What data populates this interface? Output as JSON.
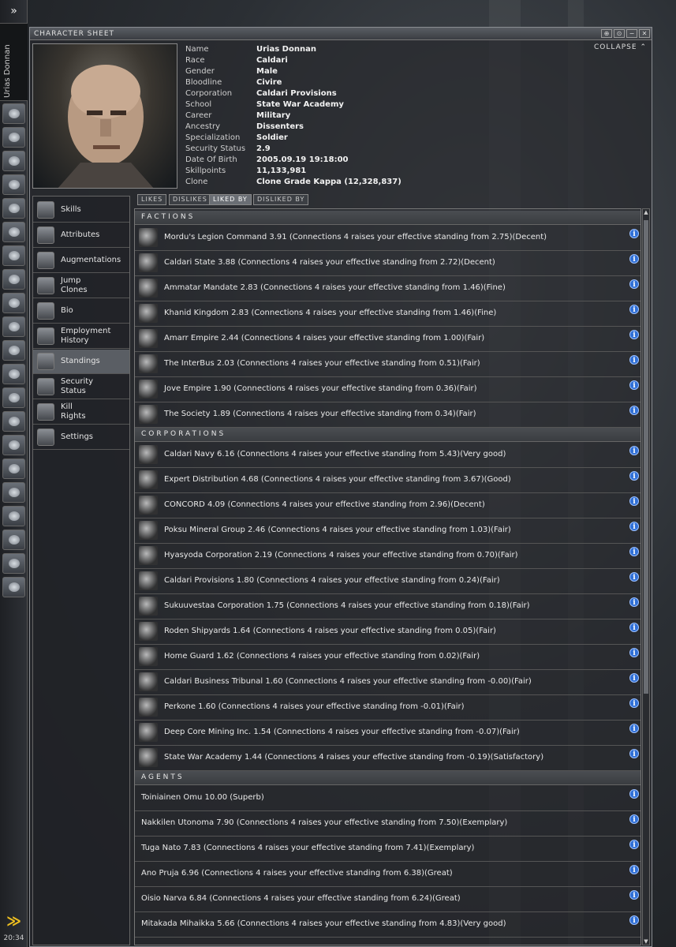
{
  "window": {
    "title": "CHARACTER SHEET",
    "collapse_label": "COLLAPSE",
    "collapse_glyph": "⌃",
    "buttons": [
      "⊕",
      "⊙",
      "−",
      "✕"
    ]
  },
  "neocom": {
    "menu_glyph": "»",
    "character_name": "Urias Donnan",
    "time": "20:34",
    "arrows_glyph": "≫"
  },
  "character": {
    "fields": [
      {
        "label": "Name",
        "value": "Urias Donnan"
      },
      {
        "label": "Race",
        "value": "Caldari"
      },
      {
        "label": "Gender",
        "value": "Male"
      },
      {
        "label": "Bloodline",
        "value": "Civire"
      },
      {
        "label": "Corporation",
        "value": "Caldari Provisions"
      },
      {
        "label": "School",
        "value": "State War Academy"
      },
      {
        "label": "Career",
        "value": "Military"
      },
      {
        "label": "Ancestry",
        "value": "Dissenters"
      },
      {
        "label": "Specialization",
        "value": "Soldier"
      },
      {
        "label": "Security Status",
        "value": "2.9"
      },
      {
        "label": "Date Of Birth",
        "value": "2005.09.19 19:18:00"
      },
      {
        "label": "Skillpoints",
        "value": "11,133,981"
      },
      {
        "label": "Clone",
        "value": "Clone Grade Kappa (12,328,837)"
      }
    ]
  },
  "nav": {
    "items": [
      {
        "label": "Skills",
        "icon": "skills-icon"
      },
      {
        "label": "Attributes",
        "icon": "attributes-icon"
      },
      {
        "label": "Augmentations",
        "icon": "augmentations-icon"
      },
      {
        "label": "Jump\nClones",
        "icon": "jump-clones-icon"
      },
      {
        "label": "Bio",
        "icon": "bio-icon"
      },
      {
        "label": "Employment\nHistory",
        "icon": "employment-history-icon"
      },
      {
        "label": "Standings",
        "icon": "standings-icon"
      },
      {
        "label": "Security\nStatus",
        "icon": "security-status-icon"
      },
      {
        "label": "Kill\nRights",
        "icon": "kill-rights-icon"
      },
      {
        "label": "Settings",
        "icon": "settings-icon"
      }
    ],
    "active": "Standings"
  },
  "tabs": [
    "LIKES",
    "DISLIKES",
    "LIKED BY",
    "DISLIKED BY"
  ],
  "active_tab": "LIKED BY",
  "standings": {
    "factions_header": "FACTIONS",
    "factions": [
      "Mordu's Legion Command 3.91 (Connections 4 raises your effective standing from 2.75)(Decent)",
      "Caldari State 3.88 (Connections 4 raises your effective standing from 2.72)(Decent)",
      "Ammatar Mandate 2.83 (Connections 4 raises your effective standing from 1.46)(Fine)",
      "Khanid Kingdom 2.83 (Connections 4 raises your effective standing from 1.46)(Fine)",
      "Amarr Empire 2.44 (Connections 4 raises your effective standing from 1.00)(Fair)",
      "The InterBus 2.03 (Connections 4 raises your effective standing from 0.51)(Fair)",
      "Jove Empire 1.90 (Connections 4 raises your effective standing from 0.36)(Fair)",
      "The Society 1.89 (Connections 4 raises your effective standing from 0.34)(Fair)"
    ],
    "corporations_header": "CORPORATIONS",
    "corporations": [
      "Caldari Navy 6.16 (Connections 4 raises your effective standing from 5.43)(Very good)",
      "Expert Distribution 4.68 (Connections 4 raises your effective standing from 3.67)(Good)",
      "CONCORD 4.09 (Connections 4 raises your effective standing from 2.96)(Decent)",
      "Poksu Mineral Group 2.46 (Connections 4 raises your effective standing from 1.03)(Fair)",
      "Hyasyoda Corporation 2.19 (Connections 4 raises your effective standing from 0.70)(Fair)",
      "Caldari Provisions 1.80 (Connections 4 raises your effective standing from 0.24)(Fair)",
      "Sukuuvestaa Corporation 1.75 (Connections 4 raises your effective standing from 0.18)(Fair)",
      "Roden Shipyards 1.64 (Connections 4 raises your effective standing from 0.05)(Fair)",
      "Home Guard 1.62 (Connections 4 raises your effective standing from 0.02)(Fair)",
      "Caldari Business Tribunal 1.60 (Connections 4 raises your effective standing from -0.00)(Fair)",
      "Perkone 1.60 (Connections 4 raises your effective standing from -0.01)(Fair)",
      "Deep Core Mining Inc. 1.54 (Connections 4 raises your effective standing from -0.07)(Fair)",
      "State War Academy 1.44 (Connections 4 raises your effective standing from -0.19)(Satisfactory)"
    ],
    "agents_header": "AGENTS",
    "agents": [
      "Toiniainen Omu 10.00 (Superb)",
      "Nakkilen Utonoma 7.90 (Connections 4 raises your effective standing from 7.50)(Exemplary)",
      "Tuga Nato 7.83 (Connections 4 raises your effective standing from 7.41)(Exemplary)",
      "Ano Pruja 6.96 (Connections 4 raises your effective standing from 6.38)(Great)",
      "Oisio Narva 6.84 (Connections 4 raises your effective standing from 6.24)(Great)",
      "Mitakada Mihaikka 5.66 (Connections 4 raises your effective standing from 4.83)(Very good)"
    ],
    "info_glyph": "i"
  },
  "colors": {
    "info_button": "#2f6fd6",
    "active_nav": "#5a5e64",
    "neocom_arrows": "#f0c020"
  }
}
